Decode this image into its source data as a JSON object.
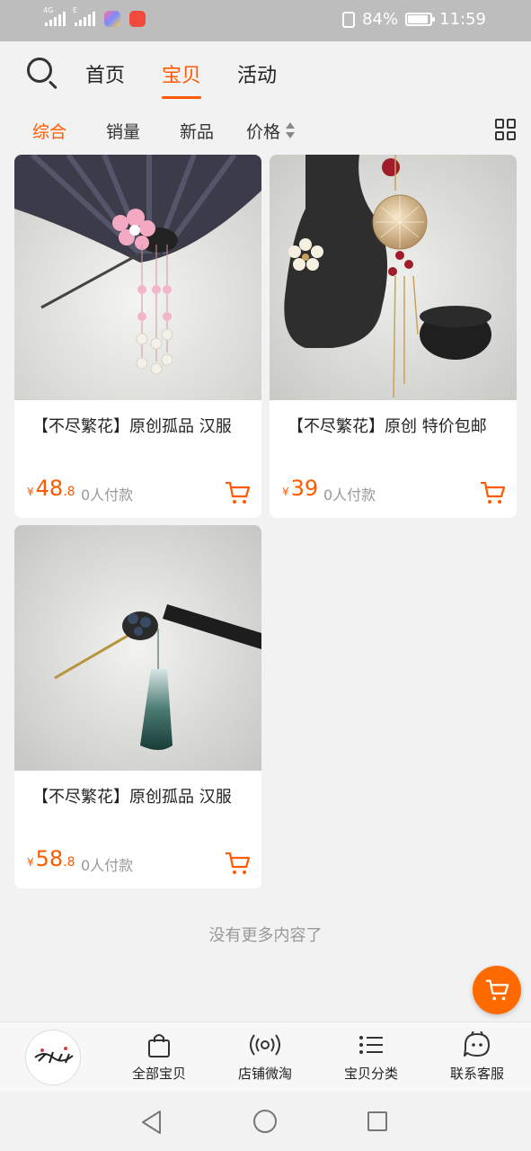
{
  "status_bar": {
    "network_left": "4G",
    "network_right": "E",
    "battery": "84%",
    "time": "11:59"
  },
  "header": {
    "tabs": [
      {
        "label": "首页"
      },
      {
        "label": "宝贝"
      },
      {
        "label": "活动"
      }
    ],
    "active_tab": "宝贝"
  },
  "sort_bar": {
    "options": [
      {
        "label": "综合"
      },
      {
        "label": "销量"
      },
      {
        "label": "新品"
      },
      {
        "label": "价格"
      }
    ],
    "active": "综合"
  },
  "products": [
    {
      "title": "【不尽繁花】原创孤品  汉服",
      "currency": "¥",
      "price_int": "48",
      "price_dec": ".8",
      "paid": "0人付款"
    },
    {
      "title": "【不尽繁花】原创  特价包邮",
      "currency": "¥",
      "price_int": "39",
      "price_dec": "",
      "paid": "0人付款"
    },
    {
      "title": "【不尽繁花】原创孤品  汉服",
      "currency": "¥",
      "price_int": "58",
      "price_dec": ".8",
      "paid": "0人付款"
    }
  ],
  "no_more_text": "没有更多内容了",
  "shop_bar": {
    "items": [
      {
        "label": "全部宝贝",
        "icon": "shopping-bag-icon"
      },
      {
        "label": "店铺微淘",
        "icon": "broadcast-icon"
      },
      {
        "label": "宝贝分类",
        "icon": "list-icon"
      },
      {
        "label": "联系客服",
        "icon": "chat-icon"
      }
    ]
  },
  "colors": {
    "accent": "#ff5a00",
    "background": "#f2f2f2",
    "card": "#ffffff"
  }
}
